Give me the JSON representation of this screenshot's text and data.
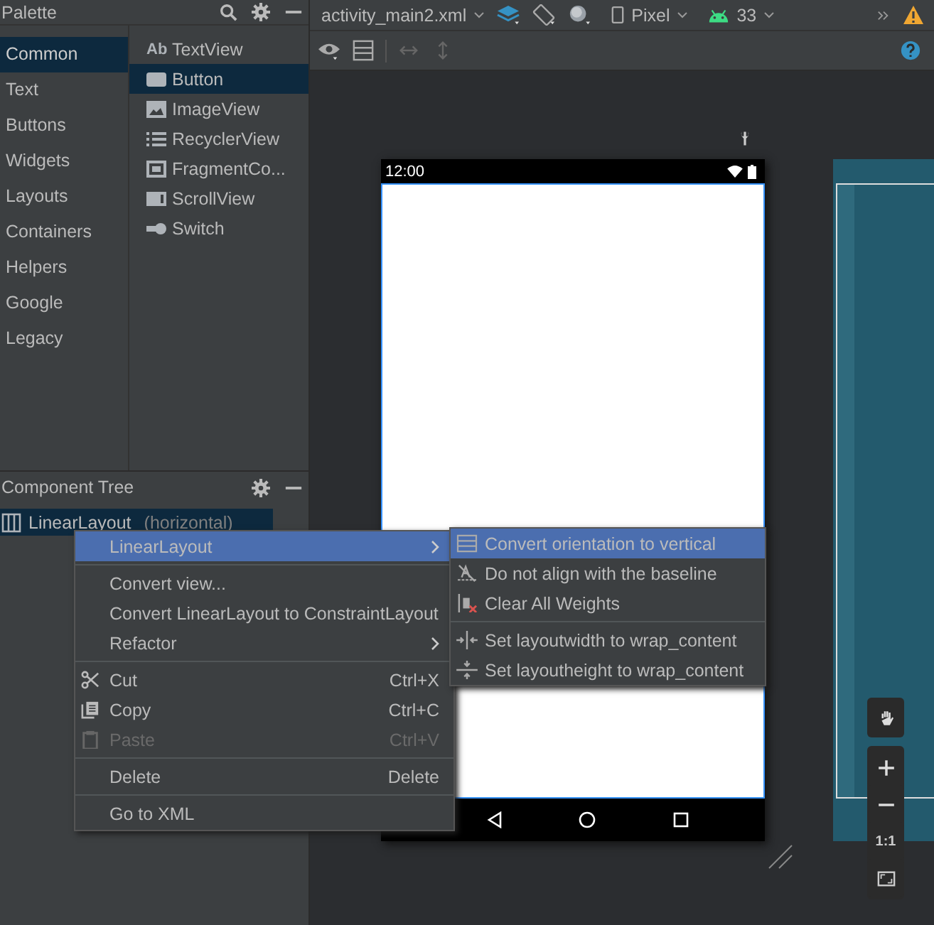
{
  "palette": {
    "title": "Palette",
    "categories": [
      {
        "label": "Common",
        "selected": true
      },
      {
        "label": "Text",
        "selected": false
      },
      {
        "label": "Buttons",
        "selected": false
      },
      {
        "label": "Widgets",
        "selected": false
      },
      {
        "label": "Layouts",
        "selected": false
      },
      {
        "label": "Containers",
        "selected": false
      },
      {
        "label": "Helpers",
        "selected": false
      },
      {
        "label": "Google",
        "selected": false
      },
      {
        "label": "Legacy",
        "selected": false
      }
    ],
    "widgets": [
      {
        "label": "TextView",
        "selected": false,
        "badge": "Ab"
      },
      {
        "label": "Button",
        "selected": true
      },
      {
        "label": "ImageView",
        "selected": false
      },
      {
        "label": "RecyclerView",
        "selected": false
      },
      {
        "label": "FragmentCo...",
        "selected": false
      },
      {
        "label": "ScrollView",
        "selected": false
      },
      {
        "label": "Switch",
        "selected": false
      }
    ]
  },
  "component_tree": {
    "title": "Component Tree",
    "nodes": [
      {
        "label": "LinearLayout",
        "detail": "(horizontal)",
        "selected": true
      }
    ]
  },
  "editor_toolbar": {
    "file_tab": "activity_main2.xml",
    "device": "Pixel",
    "api_level": "33"
  },
  "device_preview": {
    "status_time": "12:00"
  },
  "context_menu": [
    {
      "kind": "item",
      "label": "LinearLayout",
      "submenu": true,
      "selected": true,
      "disabled": false
    },
    {
      "kind": "separator"
    },
    {
      "kind": "item",
      "label": "Convert view...",
      "submenu": false,
      "selected": false,
      "disabled": false
    },
    {
      "kind": "item",
      "label": "Convert LinearLayout to ConstraintLayout",
      "submenu": false,
      "selected": false,
      "disabled": false
    },
    {
      "kind": "item",
      "label": "Refactor",
      "submenu": true,
      "selected": false,
      "disabled": false
    },
    {
      "kind": "separator"
    },
    {
      "kind": "item",
      "label": "Cut",
      "shortcut": "Ctrl+X",
      "submenu": false,
      "selected": false,
      "disabled": false
    },
    {
      "kind": "item",
      "label": "Copy",
      "shortcut": "Ctrl+C",
      "submenu": false,
      "selected": false,
      "disabled": false
    },
    {
      "kind": "item",
      "label": "Paste",
      "shortcut": "Ctrl+V",
      "submenu": false,
      "selected": false,
      "disabled": true
    },
    {
      "kind": "separator"
    },
    {
      "kind": "item",
      "label": "Delete",
      "shortcut": "Delete",
      "submenu": false,
      "selected": false,
      "disabled": false
    },
    {
      "kind": "separator"
    },
    {
      "kind": "item",
      "label": "Go to XML",
      "submenu": false,
      "selected": false,
      "disabled": false
    }
  ],
  "submenu": [
    {
      "kind": "item",
      "label": "Convert orientation to vertical",
      "selected": true
    },
    {
      "kind": "item",
      "label": "Do not align with the baseline",
      "selected": false
    },
    {
      "kind": "item",
      "label": "Clear All Weights",
      "selected": false
    },
    {
      "kind": "separator"
    },
    {
      "kind": "item",
      "label": "Set layoutwidth to wrap_content",
      "selected": false
    },
    {
      "kind": "item",
      "label": "Set layoutheight to wrap_content",
      "selected": false
    }
  ],
  "zoom_controls": {
    "actual_size": "1:1"
  }
}
